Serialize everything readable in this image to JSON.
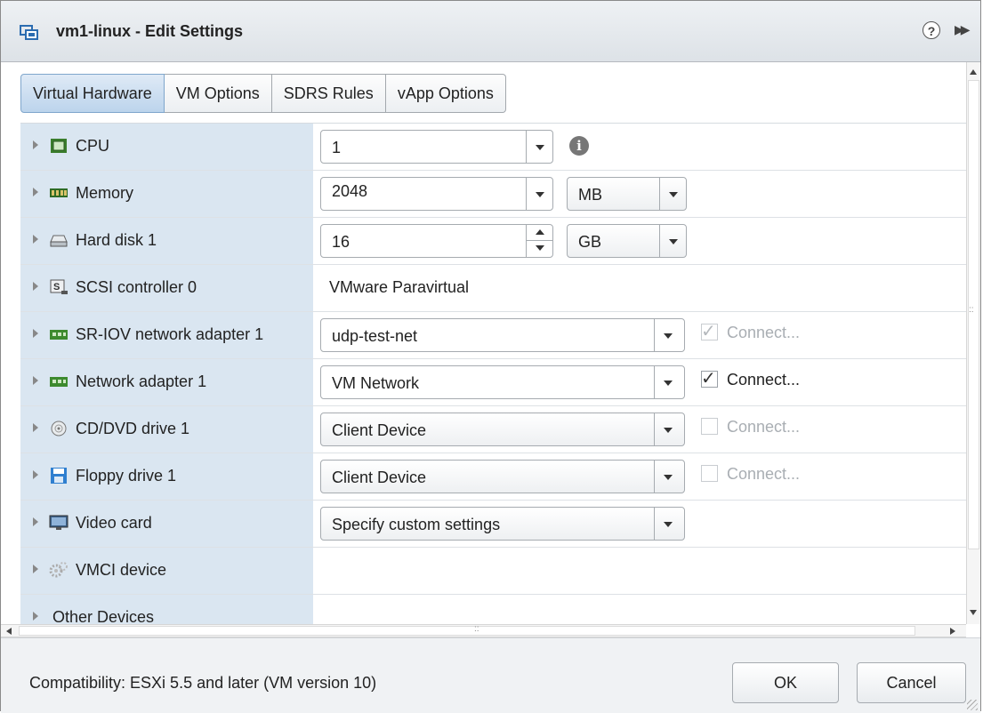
{
  "window": {
    "title": "vm1-linux - Edit Settings"
  },
  "tabs": [
    {
      "label": "Virtual Hardware",
      "active": true
    },
    {
      "label": "VM Options",
      "active": false
    },
    {
      "label": "SDRS Rules",
      "active": false
    },
    {
      "label": "vApp Options",
      "active": false
    }
  ],
  "hardware": {
    "cpu": {
      "label": "CPU",
      "value": "1"
    },
    "memory": {
      "label": "Memory",
      "value": "2048",
      "unit": "MB"
    },
    "hard_disk": {
      "label": "Hard disk 1",
      "value": "16",
      "unit": "GB"
    },
    "scsi": {
      "label": "SCSI controller 0",
      "value": "VMware Paravirtual"
    },
    "sriov": {
      "label": "SR-IOV network adapter 1",
      "value": "udp-test-net",
      "connect_label": "Connect...",
      "connect_checked": true,
      "connect_enabled": false
    },
    "network": {
      "label": "Network adapter 1",
      "value": "VM Network",
      "connect_label": "Connect...",
      "connect_checked": true,
      "connect_enabled": true
    },
    "cddvd": {
      "label": "CD/DVD drive 1",
      "value": "Client Device",
      "connect_label": "Connect...",
      "connect_checked": false,
      "connect_enabled": false
    },
    "floppy": {
      "label": "Floppy drive 1",
      "value": "Client Device",
      "connect_label": "Connect...",
      "connect_checked": false,
      "connect_enabled": false
    },
    "video": {
      "label": "Video card",
      "value": "Specify custom settings"
    },
    "vmci": {
      "label": "VMCI device"
    },
    "other": {
      "label": "Other Devices"
    }
  },
  "icons": {
    "title": "vm-settings-icon",
    "cpu": "cpu-chip-icon",
    "memory": "memory-module-icon",
    "disk": "hard-disk-icon",
    "scsi": "scsi-controller-icon",
    "nic": "network-card-icon",
    "cd": "cd-disc-icon",
    "floppy": "floppy-disk-icon",
    "video": "monitor-icon",
    "vmci": "gear-cluster-icon",
    "info": "info-icon",
    "help": "help-icon"
  },
  "footer": {
    "compatibility": "Compatibility: ESXi 5.5 and later (VM version 10)",
    "ok_label": "OK",
    "cancel_label": "Cancel"
  },
  "colors": {
    "label_column": "#dae6f1",
    "active_tab": "#bcd4ec",
    "title_bar": "#dde2e7"
  },
  "glyphs": {
    "help": "?",
    "expand": "▶▶",
    "info": "i",
    "check": "✓",
    "grip": "::"
  }
}
